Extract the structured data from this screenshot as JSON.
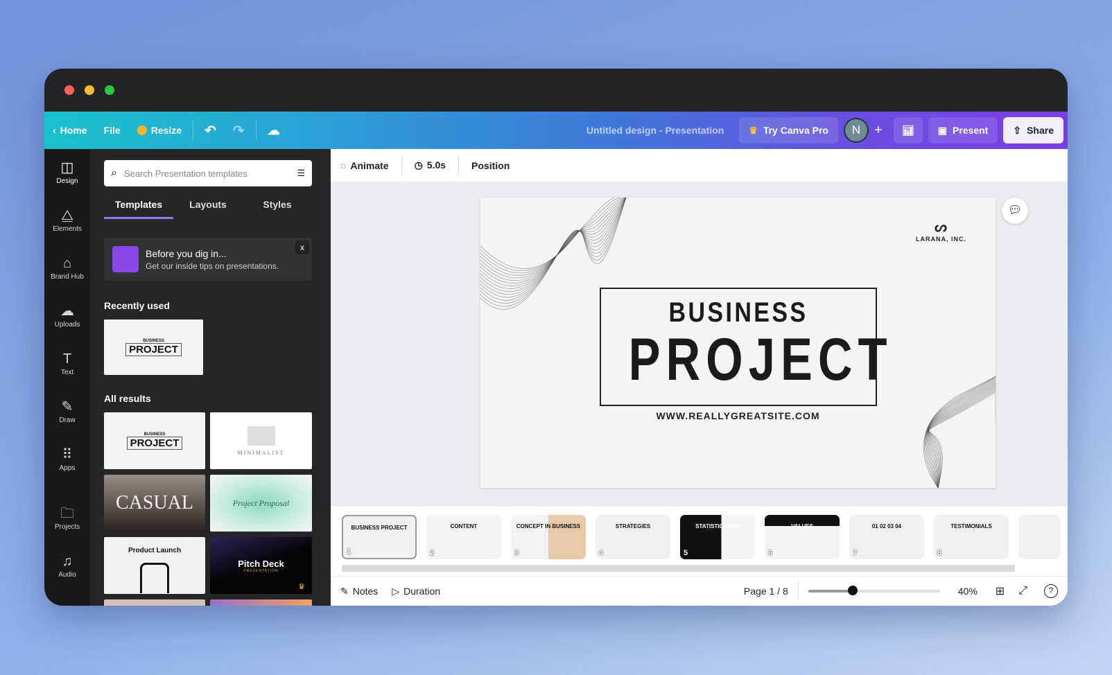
{
  "topbar": {
    "home": "Home",
    "file": "File",
    "resize": "Resize",
    "title": "Untitled design - Presentation",
    "try_pro": "Try Canva Pro",
    "avatar": "N",
    "present": "Present",
    "share": "Share"
  },
  "sidebar": {
    "items": [
      {
        "label": "Design"
      },
      {
        "label": "Elements"
      },
      {
        "label": "Brand Hub"
      },
      {
        "label": "Uploads"
      },
      {
        "label": "Text"
      },
      {
        "label": "Draw"
      },
      {
        "label": "Apps"
      },
      {
        "label": "Projects"
      },
      {
        "label": "Audio"
      }
    ]
  },
  "panel": {
    "search_placeholder": "Search Presentation templates",
    "tabs": [
      "Templates",
      "Layouts",
      "Styles"
    ],
    "tip_title": "Before you dig in...",
    "tip_body": "Get our inside tips on presentations.",
    "tip_close": "x",
    "recent_heading": "Recently used",
    "all_heading": "All results",
    "templates": [
      {
        "title": "PROJECT",
        "sub": "BUSINESS"
      },
      {
        "title": "MINIMALIST"
      },
      {
        "title": "CASUAL"
      },
      {
        "title": "Project Proposal"
      },
      {
        "title": "Product Launch"
      },
      {
        "title": "Pitch Deck",
        "sub": "PRESENTATION"
      }
    ]
  },
  "canvas_toolbar": {
    "animate": "Animate",
    "duration": "5.0s",
    "position": "Position"
  },
  "slide": {
    "logo": "LARANA, INC.",
    "kicker": "BUSINESS",
    "title": "PROJECT",
    "url": "WWW.REALLYGREATSITE.COM"
  },
  "pages": [
    {
      "n": "1",
      "label": "BUSINESS PROJECT"
    },
    {
      "n": "2",
      "label": "CONTENT"
    },
    {
      "n": "3",
      "label": "CONCEPT IN BUSINESS"
    },
    {
      "n": "4",
      "label": "STRATEGIES"
    },
    {
      "n": "5",
      "label": "STATISTICS 80%"
    },
    {
      "n": "6",
      "label": "VALUES"
    },
    {
      "n": "7",
      "label": "01 02 03 04"
    },
    {
      "n": "8",
      "label": "TESTIMONIALS"
    }
  ],
  "bottom": {
    "notes": "Notes",
    "duration": "Duration",
    "page": "Page 1 / 8",
    "zoom": "40%",
    "zoom_level": 40
  },
  "colors": {
    "accent": "#8b7cf0",
    "topbar_start": "#19c1cc",
    "topbar_end": "#7c3de6"
  }
}
